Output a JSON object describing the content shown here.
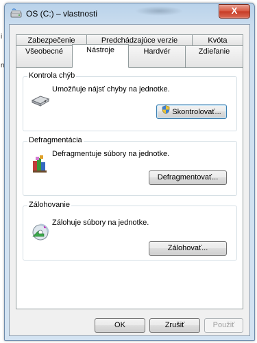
{
  "window": {
    "title": "OS (C:) – vlastnosti",
    "close_glyph": "X",
    "icon": "drive-icon"
  },
  "background": {
    "glyphs": [
      "i",
      "n"
    ]
  },
  "tabs": {
    "row1": [
      "Zabezpečenie",
      "Predchádzajúce verzie",
      "Kvóta"
    ],
    "row2": [
      "Všeobecné",
      "Nástroje",
      "Hardvér",
      "Zdieľanie"
    ],
    "active": "Nástroje"
  },
  "groups": {
    "error_check": {
      "title": "Kontrola chýb",
      "description": "Umožňuje nájsť chyby na jednotke.",
      "button": "Skontrolovať...",
      "icon": "disk-check-icon"
    },
    "defrag": {
      "title": "Defragmentácia",
      "description": "Defragmentuje súbory na jednotke.",
      "button": "Defragmentovať...",
      "icon": "defragment-icon"
    },
    "backup": {
      "title": "Zálohovanie",
      "description": "Zálohuje súbory na jednotke.",
      "button": "Zálohovať...",
      "icon": "backup-icon"
    }
  },
  "footer": {
    "ok": "OK",
    "cancel": "Zrušiť",
    "apply": "Použiť"
  }
}
